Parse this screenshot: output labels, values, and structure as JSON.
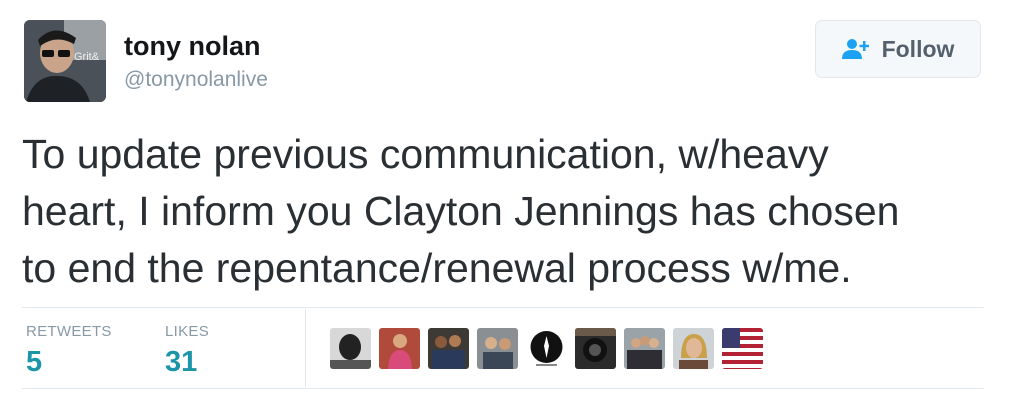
{
  "user": {
    "name": "tony nolan",
    "handle": "@tonynolanlive",
    "avatar_text": "Grit&"
  },
  "follow_button": {
    "label": "Follow",
    "icon": "add-user-icon"
  },
  "tweet": {
    "lines": [
      "To update previous communication, w/heavy",
      "heart, I inform you Clayton Jennings has chosen",
      "to end the repentance/renewal process w/me."
    ]
  },
  "stats": {
    "retweets_label": "RETWEETS",
    "retweets_count": "5",
    "likes_label": "LIKES",
    "likes_count": "31"
  },
  "likers": [
    {
      "name": "liker-avatar-1"
    },
    {
      "name": "liker-avatar-2"
    },
    {
      "name": "liker-avatar-3"
    },
    {
      "name": "liker-avatar-4"
    },
    {
      "name": "liker-avatar-5"
    },
    {
      "name": "liker-avatar-6"
    },
    {
      "name": "liker-avatar-7"
    },
    {
      "name": "liker-avatar-8"
    },
    {
      "name": "liker-avatar-9"
    }
  ],
  "colors": {
    "accent": "#1b95a7",
    "muted": "#8899a6",
    "text": "#292f33",
    "follow_icon": "#1da1f2"
  }
}
